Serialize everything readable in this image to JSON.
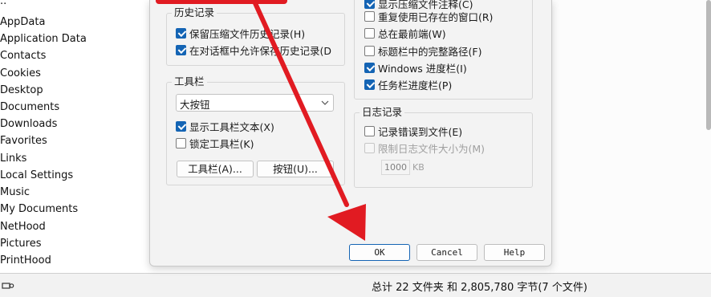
{
  "file_list": {
    "items": [
      "..",
      "AppData",
      "Application Data",
      "Contacts",
      "Cookies",
      "Desktop",
      "Documents",
      "Downloads",
      "Favorites",
      "Links",
      "Local Settings",
      "Music",
      "My Documents",
      "NetHood",
      "Pictures",
      "PrintHood"
    ]
  },
  "dialog": {
    "top_partial_label": "显示压缩文件注释(C)",
    "history": {
      "title": "历史记录",
      "items": [
        {
          "label": "保留压缩文件历史记录(H)",
          "checked": true
        },
        {
          "label": "在对话框中允许保存历史记录(D",
          "checked": true
        }
      ]
    },
    "toolbar": {
      "title": "工具栏",
      "combo_value": "大按钮",
      "items": [
        {
          "label": "显示工具栏文本(X)",
          "checked": true
        },
        {
          "label": "锁定工具栏(K)",
          "checked": false
        }
      ],
      "buttons": [
        "工具栏(A)...",
        "按钮(U)..."
      ]
    },
    "window": {
      "items": [
        {
          "label": "重复使用已存在的窗口(R)",
          "checked": false
        },
        {
          "label": "总在最前端(W)",
          "checked": false
        },
        {
          "label": "标题栏中的完整路径(F)",
          "checked": false
        },
        {
          "label": "Windows 进度栏(I)",
          "checked": true
        },
        {
          "label": "任务栏进度栏(P)",
          "checked": true
        }
      ]
    },
    "log": {
      "title": "日志记录",
      "items": [
        {
          "label": "记录错误到文件(E)",
          "checked": false,
          "disabled": false
        },
        {
          "label": "限制日志文件大小为(M)",
          "checked": false,
          "disabled": true
        }
      ],
      "size_value": "1000",
      "size_unit": "KB"
    },
    "buttons": {
      "ok": "OK",
      "cancel": "Cancel",
      "help": "Help"
    }
  },
  "status_bar": {
    "summary": "总计 22 文件夹 和 2,805,780 字节(7 个文件)",
    "icon": "drive-link-icon"
  },
  "annotation": {
    "color": "#e11b22",
    "icon": "red-arrow-icon"
  },
  "colors": {
    "accent": "#1464b4"
  }
}
